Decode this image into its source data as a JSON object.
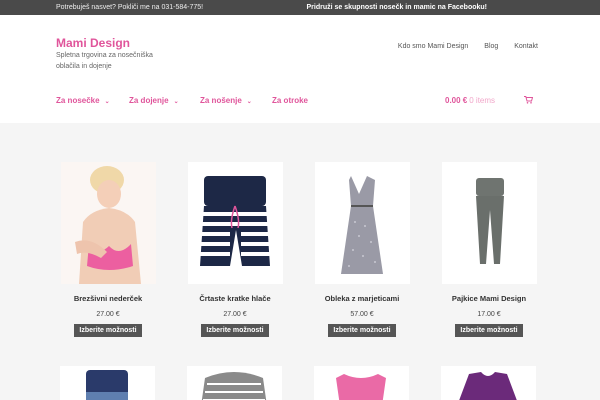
{
  "topbar": {
    "left_text": "Potrebuješ nasvet? Pokliči me na 031-584-775!",
    "right_text": "Pridruži se skupnosti nosečk in mamic na Facebooku!"
  },
  "header": {
    "logo": "Mami Design",
    "tagline": "Spletna trgovina za nosečniška oblačila in dojenje",
    "top_nav": [
      "Kdo smo Mami Design",
      "Blog",
      "Kontakt"
    ]
  },
  "main_nav": [
    {
      "label": "Za nosečke",
      "has_dropdown": true
    },
    {
      "label": "Za dojenje",
      "has_dropdown": true
    },
    {
      "label": "Za nošenje",
      "has_dropdown": true
    },
    {
      "label": "Za otroke",
      "has_dropdown": false
    }
  ],
  "cart": {
    "total": "0.00 €",
    "items": "0 items",
    "icon": "cart-icon"
  },
  "products": [
    {
      "name": "Brezšivni nederček",
      "price": "27.00 €",
      "button": "Izberite možnosti"
    },
    {
      "name": "Črtaste kratke hlače",
      "price": "27.00 €",
      "button": "Izberite možnosti"
    },
    {
      "name": "Obleka z marjeticami",
      "price": "57.00 €",
      "button": "Izberite možnosti"
    },
    {
      "name": "Pajkice Mami Design",
      "price": "17.00 €",
      "button": "Izberite možnosti"
    }
  ],
  "colors": {
    "accent": "#e0559b",
    "topbar": "#4a4a4a",
    "button": "#555555"
  }
}
